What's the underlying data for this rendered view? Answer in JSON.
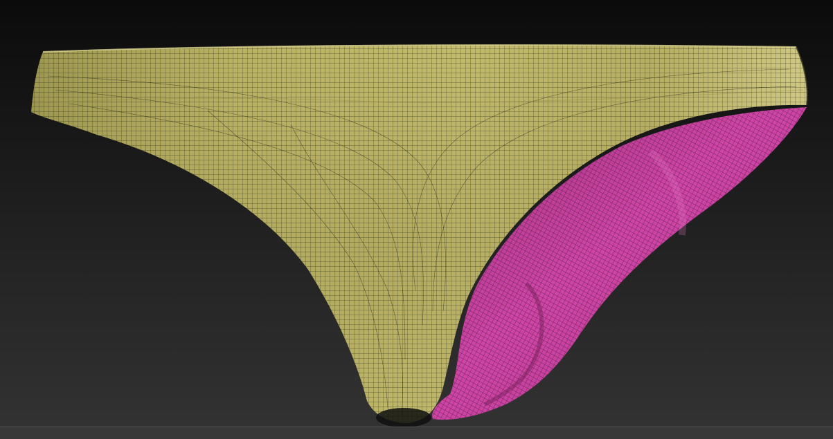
{
  "viewport": {
    "background_top": "#0b0b0b",
    "background_mid": "#1e1e1e",
    "background_bottom": "#333333"
  },
  "model": {
    "outer_color": "#bdb566",
    "outer_shadow": "#8f8a46",
    "outer_highlight": "#d6cf86",
    "inner_color": "#c83d9e",
    "inner_shadow": "#8a2a6c",
    "inner_highlight": "#df5fb7",
    "wire_color": "#1a1a14",
    "inner_wire_color": "#2a0f22"
  }
}
